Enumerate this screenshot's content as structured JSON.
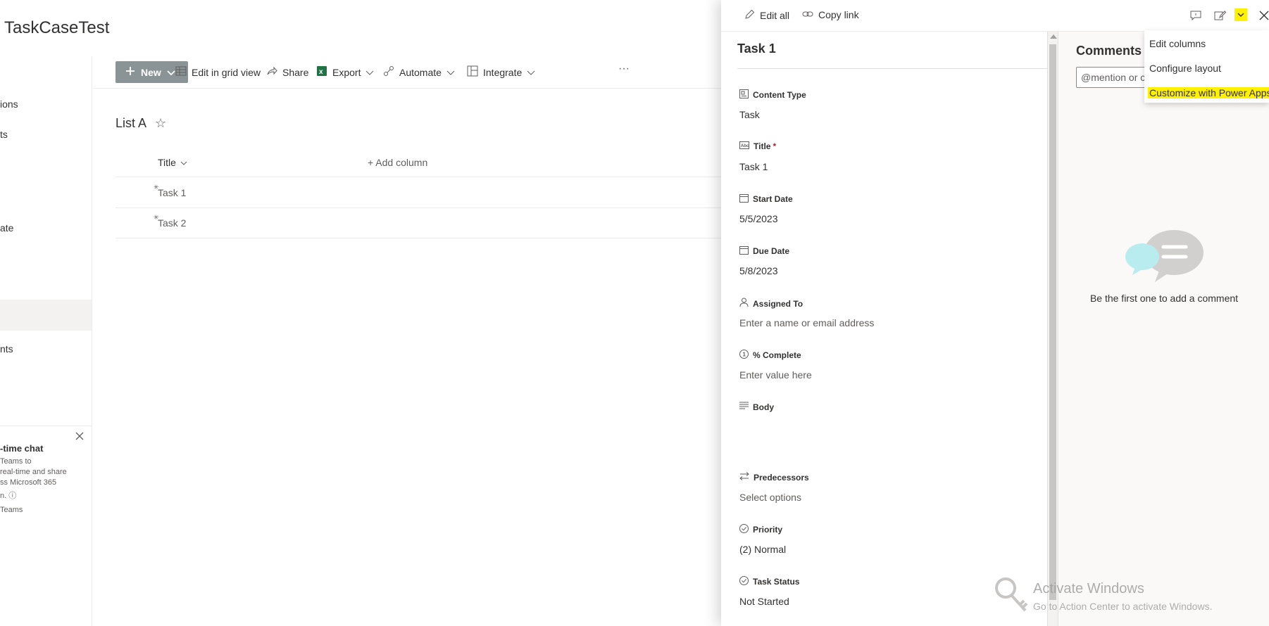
{
  "site": {
    "title": "TaskCaseTest"
  },
  "leftnav": {
    "items": [
      "ions",
      "ts",
      "ate",
      "nts"
    ]
  },
  "teams_card": {
    "title": "-time chat",
    "lines": [
      "Teams to",
      "real-time and share",
      "ss Microsoft 365",
      "n.",
      "Teams"
    ]
  },
  "commandbar": {
    "new_label": "New",
    "edit_grid_label": "Edit in grid view",
    "share_label": "Share",
    "export_label": "Export",
    "automate_label": "Automate",
    "integrate_label": "Integrate",
    "more_label": "···"
  },
  "list": {
    "title": "List A",
    "star_icon": "☆",
    "columns": {
      "title": "Title",
      "add_column": "+ Add column"
    },
    "rows": [
      {
        "title": "Task 1"
      },
      {
        "title": "Task 2"
      }
    ]
  },
  "panel": {
    "edit_all_label": "Edit all",
    "copy_link_label": "Copy link",
    "form": {
      "title": "Task 1",
      "fields": [
        {
          "icon": "content-type-icon",
          "label": "Content Type",
          "value": "Task",
          "placeholder": false
        },
        {
          "icon": "text-field-icon",
          "label": "Title",
          "required_mark": "*",
          "value": "Task 1",
          "placeholder": false
        },
        {
          "icon": "calendar-icon",
          "label": "Start Date",
          "value": "5/5/2023",
          "placeholder": false
        },
        {
          "icon": "calendar-icon",
          "label": "Due Date",
          "value": "5/8/2023",
          "placeholder": false
        },
        {
          "icon": "person-icon",
          "label": "Assigned To",
          "value": "Enter a name or email address",
          "placeholder": true
        },
        {
          "icon": "number-icon",
          "label": "% Complete",
          "value": "Enter value here",
          "placeholder": true
        },
        {
          "icon": "multiline-text-icon",
          "label": "Body",
          "value": "",
          "placeholder": false
        },
        {
          "icon": "switch-arrows-icon",
          "label": "Predecessors",
          "value": "Select options",
          "placeholder": true
        },
        {
          "icon": "choice-icon",
          "label": "Priority",
          "value": "(2) Normal",
          "placeholder": false
        },
        {
          "icon": "choice-icon",
          "label": "Task Status",
          "value": "Not Started",
          "placeholder": false
        }
      ]
    },
    "comments": {
      "title": "Comments",
      "input_placeholder": "@mention or co",
      "empty_text": "Be the first one to add a comment"
    },
    "menu": {
      "items": [
        "Edit columns",
        "Configure layout",
        "Customize with Power Apps"
      ],
      "highlight_color": "#fff100"
    }
  },
  "watermark": {
    "line1": "Activate Windows",
    "line2": "Go to Action Center to activate Windows."
  },
  "colors": {
    "new_button": "#8a9497",
    "highlight": "#fff100",
    "excel_green": "#217346"
  }
}
